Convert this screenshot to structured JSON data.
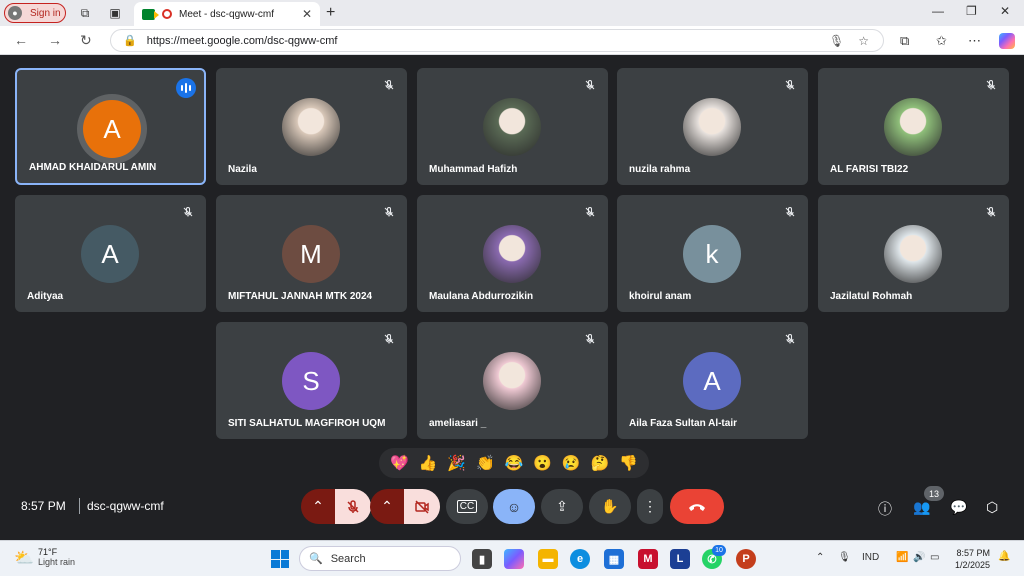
{
  "browser": {
    "signin_label": "Sign in",
    "tab_title": "Meet - dsc-qgww-cmf",
    "url": "https://meet.google.com/dsc-qgww-cmf"
  },
  "participants": [
    {
      "name": "AHMAD KHAIDARUL AMIN",
      "initial": "A",
      "avatar_color": "#e8710a",
      "speaking": true,
      "photo": false
    },
    {
      "name": "Nazila",
      "initial": "",
      "avatar_color": "#d8c7b8",
      "photo": true
    },
    {
      "name": "Muhammad Hafizh",
      "initial": "",
      "avatar_color": "#5a6a55",
      "photo": true
    },
    {
      "name": "nuzila rahma",
      "initial": "",
      "avatar_color": "#e6e0dc",
      "photo": true
    },
    {
      "name": "AL FARISI TBI22",
      "initial": "",
      "avatar_color": "#8fbf7a",
      "photo": true
    },
    {
      "name": "Adityaa",
      "initial": "A",
      "avatar_color": "#455a64",
      "photo": false
    },
    {
      "name": "MIFTAHUL JANNAH MTK 2024",
      "initial": "M",
      "avatar_color": "#6d4c41",
      "photo": false
    },
    {
      "name": "Maulana Abdurrozikin",
      "initial": "",
      "avatar_color": "#8a6ab0",
      "photo": true
    },
    {
      "name": "khoirul anam",
      "initial": "k",
      "avatar_color": "#78909c",
      "photo": false
    },
    {
      "name": "Jazilatul Rohmah",
      "initial": "",
      "avatar_color": "#dfe6ea",
      "photo": true
    },
    {
      "name": "SITI SALHATUL MAGFIROH UQM",
      "initial": "S",
      "avatar_color": "#7e57c2",
      "photo": false
    },
    {
      "name": "ameliasari _",
      "initial": "",
      "avatar_color": "#efc9d3",
      "photo": true
    },
    {
      "name": "Aila Faza Sultan Al-tair",
      "initial": "A",
      "avatar_color": "#5c6bc0",
      "photo": false
    }
  ],
  "reactions": [
    "💖",
    "👍",
    "🎉",
    "👏",
    "😂",
    "😮",
    "😢",
    "🤔",
    "👎"
  ],
  "bottom": {
    "time": "8:57 PM",
    "meeting_code": "dsc-qgww-cmf",
    "people_count": "13"
  },
  "taskbar": {
    "temperature": "71°F",
    "weather": "Light rain",
    "search_label": "Search",
    "whatsapp_badge": "10",
    "language": "IND",
    "time": "8:57 PM",
    "date": "1/2/2025"
  }
}
